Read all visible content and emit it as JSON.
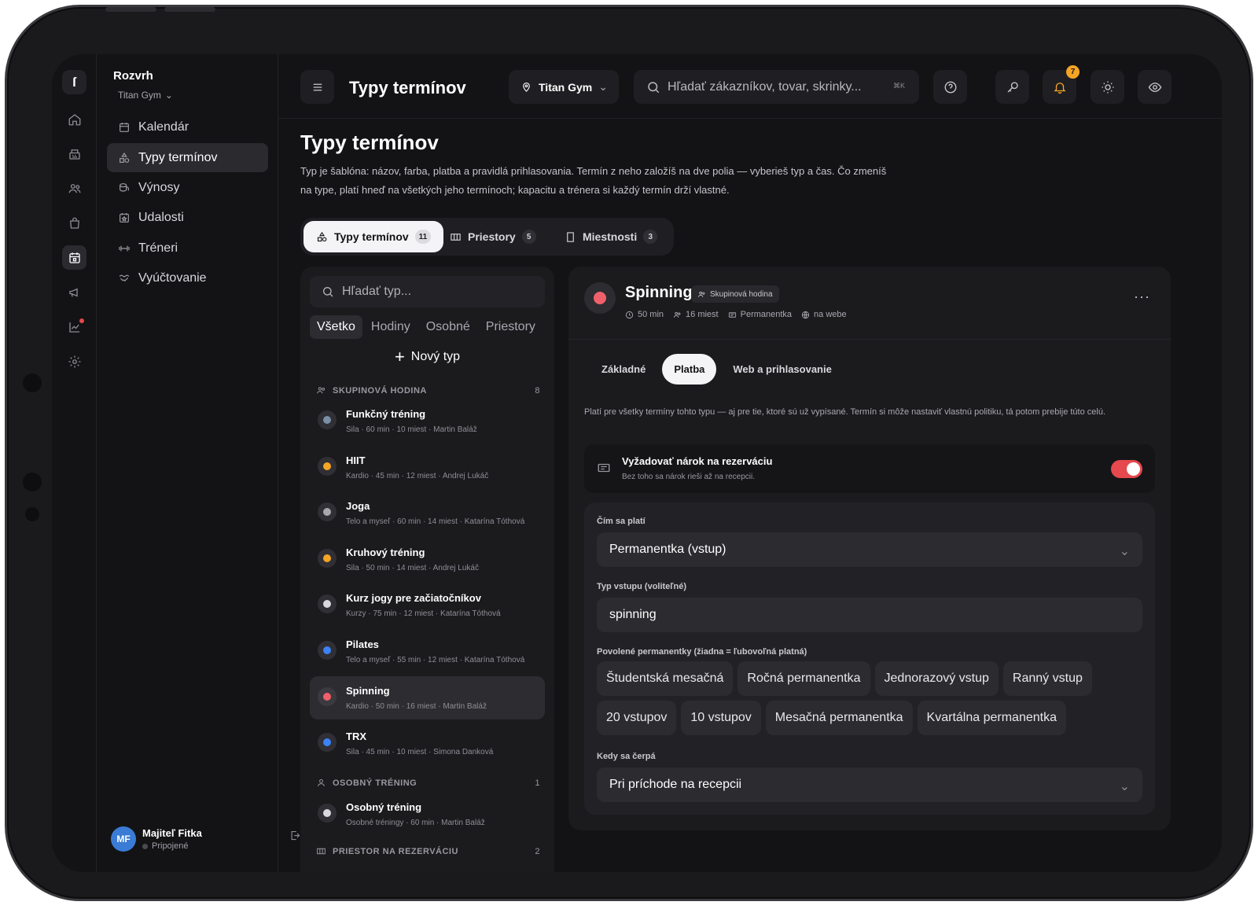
{
  "rail": {
    "logo": "ſ"
  },
  "nav": {
    "title": "Rozvrh",
    "gym": "Titan Gym",
    "items": [
      {
        "label": "Kalendár"
      },
      {
        "label": "Typy termínov"
      },
      {
        "label": "Výnosy"
      },
      {
        "label": "Udalosti"
      },
      {
        "label": "Tréneri"
      },
      {
        "label": "Vyúčtovanie"
      }
    ],
    "user": {
      "initials": "MF",
      "name": "Majiteľ Fitka",
      "status": "Pripojené"
    }
  },
  "topbar": {
    "title": "Typy termínov",
    "gym": "Titan Gym",
    "search_placeholder": "Hľadať zákazníkov, tovar, skrinky...",
    "shortcut": "⌘K",
    "notifications": "7"
  },
  "page": {
    "title": "Typy termínov",
    "description": "Typ je šablóna: názov, farba, platba a pravidlá prihlasovania. Termín z neho založíš na dve polia — vyberieš typ a čas. Čo zmeníš na type, platí hneď na všetkých jeho termínoch; kapacitu a trénera si každý termín drží vlastné."
  },
  "segments": [
    {
      "label": "Typy termínov",
      "count": "11"
    },
    {
      "label": "Priestory",
      "count": "5"
    },
    {
      "label": "Miestnosti",
      "count": "3"
    }
  ],
  "list": {
    "search_placeholder": "Hľadať typ...",
    "filters": [
      "Všetko",
      "Hodiny",
      "Osobné",
      "Priestory"
    ],
    "new_type": "Nový typ",
    "groups": [
      {
        "title": "SKUPINOVÁ HODINA",
        "count": "8"
      },
      {
        "title": "OSOBNÝ TRÉNING",
        "count": "1"
      },
      {
        "title": "PRIESTOR NA REZERVÁCIU",
        "count": "2"
      }
    ],
    "items": [
      {
        "name": "Funkčný tréning",
        "meta": "Sila · 60 min · 10 miest · Martin Baláž",
        "color": "#7a8fa8"
      },
      {
        "name": "HIIT",
        "meta": "Kardio · 45 min · 12 miest · Andrej Lukáč",
        "color": "#f5a524"
      },
      {
        "name": "Joga",
        "meta": "Telo a myseľ · 60 min · 14 miest · Katarína Tóthová",
        "color": "#a8a8b0"
      },
      {
        "name": "Kruhový tréning",
        "meta": "Sila · 50 min · 14 miest · Andrej Lukáč",
        "color": "#f5a524"
      },
      {
        "name": "Kurz jogy pre začiatočníkov",
        "meta": "Kurzy · 75 min · 12 miest · Katarína Tóthová",
        "color": "#d8d8de"
      },
      {
        "name": "Pilates",
        "meta": "Telo a myseľ · 55 min · 12 miest · Katarína Tóthová",
        "color": "#3b82f6"
      },
      {
        "name": "Spinning",
        "meta": "Kardio · 50 min · 16 miest · Martin Baláž",
        "color": "#f0606a"
      },
      {
        "name": "TRX",
        "meta": "Sila · 45 min · 10 miest · Simona Danková",
        "color": "#3b82f6"
      },
      {
        "name": "Osobný tréning",
        "meta": "Osobné tréningy · 60 min · Martin Baláž",
        "color": "#d8d8de"
      }
    ]
  },
  "detail": {
    "name": "Spinning",
    "tag": "Skupinová hodina",
    "meta": [
      "50 min",
      "16 miest",
      "Permanentka",
      "na webe"
    ],
    "tabs": [
      "Základné",
      "Platba",
      "Web a prihlasovanie"
    ],
    "payment_desc": "Platí pre všetky termíny tohto typu — aj pre tie, ktoré sú už vypísané. Termín si môže nastaviť vlastnú politiku, tá potom prebije túto celú.",
    "toggle": {
      "title": "Vyžadovať nárok na rezerváciu",
      "subtitle": "Bez toho sa nárok rieši až na recepcii.",
      "on": true
    },
    "fields": {
      "pay_label": "Čím sa platí",
      "pay_value": "Permanentka (vstup)",
      "entry_label": "Typ vstupu (voliteľné)",
      "entry_value": "spinning",
      "passes_label": "Povolené permanentky (žiadna = ľubovoľná platná)",
      "passes": [
        "Študentská mesačná",
        "Ročná permanentka",
        "Jednorazový vstup",
        "Ranný vstup",
        "20 vstupov",
        "10 vstupov",
        "Mesačná permanentka",
        "Kvartálna permanentka"
      ],
      "draw_label": "Kedy sa čerpá",
      "draw_value": "Pri príchode na recepcii"
    }
  },
  "colors": {
    "accent_red": "#e5484d",
    "badge": "#f5a524",
    "avatar": "#3a7bd5"
  }
}
